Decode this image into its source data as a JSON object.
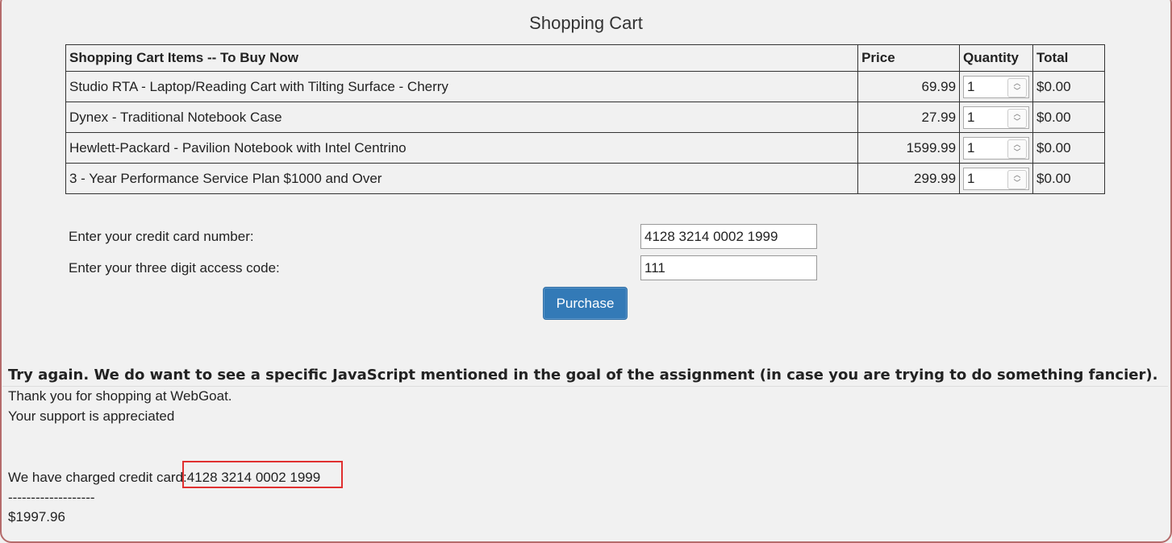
{
  "page": {
    "title": "Shopping Cart"
  },
  "cart": {
    "headers": [
      "Shopping Cart Items -- To Buy Now",
      "Price",
      "Quantity",
      "Total"
    ],
    "rows": [
      {
        "item": "Studio RTA - Laptop/Reading Cart with Tilting Surface - Cherry",
        "price": "69.99",
        "qty": "1",
        "total": "$0.00"
      },
      {
        "item": "Dynex - Traditional Notebook Case",
        "price": "27.99",
        "qty": "1",
        "total": "$0.00"
      },
      {
        "item": "Hewlett-Packard - Pavilion Notebook with Intel Centrino",
        "price": "1599.99",
        "qty": "1",
        "total": "$0.00"
      },
      {
        "item": "3 - Year Performance Service Plan $1000 and Over",
        "price": "299.99",
        "qty": "1",
        "total": "$0.00"
      }
    ]
  },
  "form": {
    "cc_label": "Enter your credit card number:",
    "cc_value": "4128 3214 0002 1999",
    "code_label": "Enter your three digit access code:",
    "code_value": "111",
    "purchase_label": "Purchase"
  },
  "feedback": {
    "message": "Try again. We do want to see a specific JavaScript mentioned in the goal of the assignment (in case you are trying to do something fancier)."
  },
  "output": {
    "line1": "Thank you for shopping at WebGoat.",
    "line2": "Your support is appreciated",
    "charged_prefix": "We have charged credit card:",
    "charged_card": "4128 3214 0002 1999",
    "separator": "-------------------",
    "amount": "$1997.96"
  },
  "colors": {
    "accent": "#337ab7",
    "highlight": "#e03030"
  }
}
